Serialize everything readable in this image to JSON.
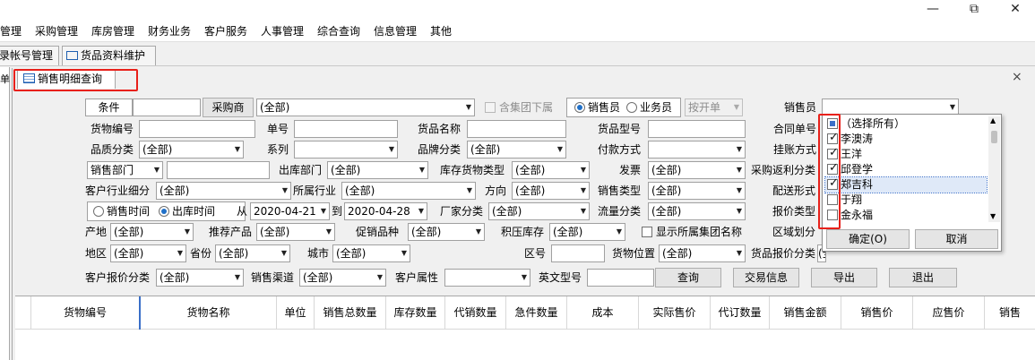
{
  "window": {
    "minimize": "—",
    "restore": "⧉",
    "close": "✕"
  },
  "menu": [
    "管理",
    "采购管理",
    "库房管理",
    "财务业务",
    "客户服务",
    "人事管理",
    "综合查询",
    "信息管理",
    "其他"
  ],
  "top_tabs": [
    "录帐号管理",
    "货品资料维护"
  ],
  "side_stub": "单",
  "panel_tab": "销售明细查询",
  "panel_close": "×",
  "form": {
    "tiaojian": "条件",
    "caigoushang_btn": "采购商",
    "caigoushang_val": "(全部)",
    "jituan": "含集团下属",
    "radio_xsy": "销售员",
    "radio_ywy": "业务员",
    "kaikaidan": "按开单",
    "xiaoshouyuan": "销售员",
    "huowubianhao": "货物编号",
    "danhao": "单号",
    "huopinmingcheng": "货品名称",
    "huopinxinghao": "货品型号",
    "hetongdanhao": "合同单号",
    "zhiliangfenlei": "品质分类",
    "zhiliangfenlei_val": "(全部)",
    "xilie": "系列",
    "pinpaifenlei": "品牌分类",
    "pinpaifenlei_val": "(全部)",
    "fukuanfangshi": "付款方式",
    "guazhangfangshi": "挂账方式",
    "xiaoshoubumen": "销售部门",
    "chukubumen": "出库部门",
    "chukubumen_val": "(全部)",
    "kucunhuowuleixing": "库存货物类型",
    "kucunhuowuleixing_val": "(全部)",
    "fapiao": "发票",
    "fapiao_val": "(全部)",
    "caigoufanli": "采购返利分类",
    "kehuhangye": "客户行业细分",
    "kehuhangye_val": "(全部)",
    "suoshuhangye": "所属行业",
    "suoshuhangye_val": "(全部)",
    "fangxiang": "方向",
    "fangxiang_val": "(全部)",
    "xiaoshouleixing": "销售类型",
    "xiaoshouleixing_val": "(全部)",
    "peisongxingshi": "配送形式",
    "radio_xssj": "销售时间",
    "radio_cksj": "出库时间",
    "cong": "从",
    "date_from": "2020-04-21",
    "dao": "到",
    "date_to": "2020-04-28",
    "changjiafenlei": "厂家分类",
    "changjiafenlei_val": "(全部)",
    "liuliangfenlei": "流量分类",
    "liuliangfenlei_val": "(全部)",
    "baojialeixing": "报价类型",
    "chandi": "产地",
    "chandi_val": "(全部)",
    "tuijianchanpin": "推荐产品",
    "tuijianchanpin_val": "(全部)",
    "cuxiaopinzhong": "促销品种",
    "cuxiaopinzhong_val": "(全部)",
    "jiyakucun": "积压库存",
    "jiyakucun_val": "(全部)",
    "xianshijituan": "显示所属集团名称",
    "quyuhuafen": "区域划分",
    "diqu": "地区",
    "diqu_val": "(全部)",
    "shengfen": "省份",
    "shengfen_val": "(全部)",
    "chengshi": "城市",
    "chengshi_val": "(全部)",
    "quhao": "区号",
    "huowuweizhi": "货物位置",
    "huowuweizhi_val": "(全部)",
    "huopinbaojia": "货品报价分类",
    "huopinbaojia_val": "(全部)",
    "kehubaojia": "客户报价分类",
    "kehubaojia_val": "(全部)",
    "xiaoshouqudao": "销售渠道",
    "xiaoshouqudao_val": "(全部)",
    "kehushuxing": "客户属性",
    "yingwenxinghao": "英文型号",
    "btn_query": "查询",
    "btn_jiaoyi": "交易信息",
    "btn_export": "导出",
    "btn_exit": "退出"
  },
  "grid_headers": [
    "货物编号",
    "货物名称",
    "单位",
    "销售总数量",
    "库存数量",
    "代销数量",
    "急件数量",
    "成本",
    "实际售价",
    "代订数量",
    "销售金额",
    "销售价",
    "应售价",
    "销售"
  ],
  "dropdown": {
    "items": [
      {
        "label": "（选择所有）",
        "state": "partial"
      },
      {
        "label": "李澳涛",
        "state": "checked"
      },
      {
        "label": "王洋",
        "state": "checked"
      },
      {
        "label": "邱登学",
        "state": "checked"
      },
      {
        "label": "郑吉科",
        "state": "checked"
      },
      {
        "label": "于翔",
        "state": "unchecked"
      },
      {
        "label": "金永福",
        "state": "unchecked"
      }
    ],
    "ok": "确定(O)",
    "cancel": "取消"
  },
  "colors": {
    "highlight_red": "#e8201a",
    "selection_blue": "#3a6fc8"
  }
}
